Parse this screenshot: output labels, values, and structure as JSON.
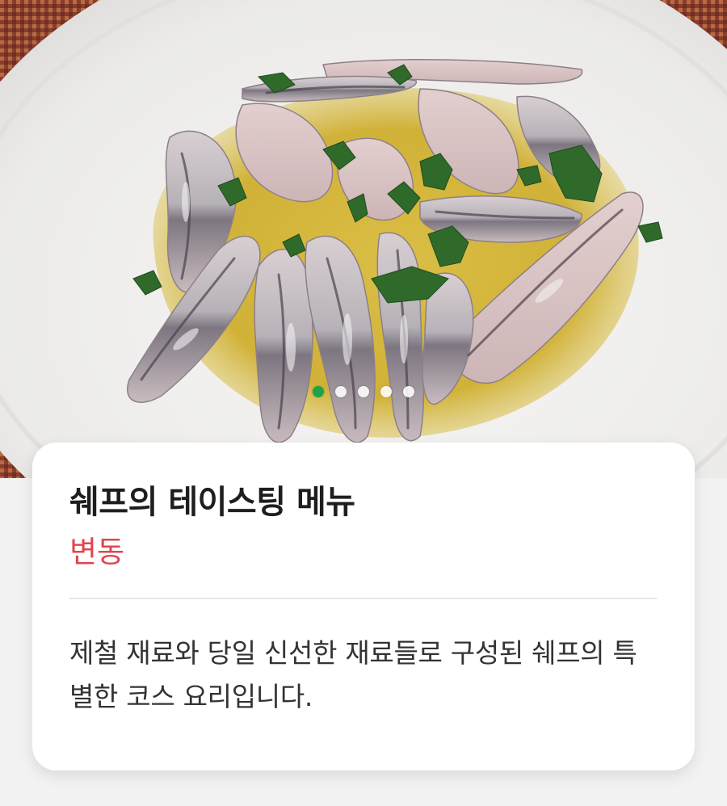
{
  "hero": {
    "image_subject": "marinated anchovies with olive oil and parsley on white plate",
    "carousel": {
      "total": 5,
      "active_index": 0
    }
  },
  "menu": {
    "title": "쉐프의 테이스팅 메뉴",
    "price": "변동",
    "description": "제철 재료와 당일 신선한 재료들로 구성된 쉐프의 특별한 코스 요리입니다."
  },
  "colors": {
    "price_accent": "#e0464f",
    "dot_active": "#1fa34a",
    "dot_inactive": "#ffffff"
  }
}
